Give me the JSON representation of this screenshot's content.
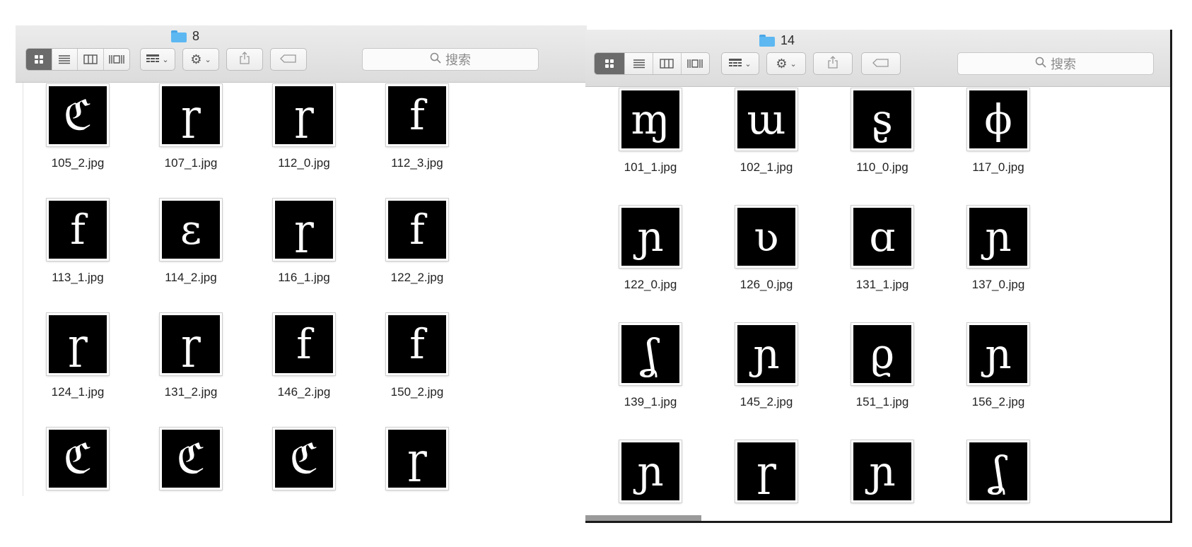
{
  "left_window": {
    "title": "8",
    "search_placeholder": "搜索",
    "files": [
      {
        "name": "105_2.jpg",
        "glyph": "ℭ"
      },
      {
        "name": "107_1.jpg",
        "glyph": "ɼ"
      },
      {
        "name": "112_0.jpg",
        "glyph": "ɼ"
      },
      {
        "name": "112_3.jpg",
        "glyph": "f"
      },
      {
        "name": "113_1.jpg",
        "glyph": "f"
      },
      {
        "name": "114_2.jpg",
        "glyph": "ɛ"
      },
      {
        "name": "116_1.jpg",
        "glyph": "ɼ"
      },
      {
        "name": "122_2.jpg",
        "glyph": "f"
      },
      {
        "name": "124_1.jpg",
        "glyph": "ɼ"
      },
      {
        "name": "131_2.jpg",
        "glyph": "ɼ"
      },
      {
        "name": "146_2.jpg",
        "glyph": "f"
      },
      {
        "name": "150_2.jpg",
        "glyph": "f"
      },
      {
        "name": "",
        "glyph": "ℭ"
      },
      {
        "name": "",
        "glyph": "ℭ"
      },
      {
        "name": "",
        "glyph": "ℭ"
      },
      {
        "name": "",
        "glyph": "ɼ"
      }
    ]
  },
  "right_window": {
    "title": "14",
    "search_placeholder": "搜索",
    "files": [
      {
        "name": "101_1.jpg",
        "glyph": "ɱ"
      },
      {
        "name": "102_1.jpg",
        "glyph": "ɯ"
      },
      {
        "name": "110_0.jpg",
        "glyph": "ʂ"
      },
      {
        "name": "117_0.jpg",
        "glyph": "ϕ"
      },
      {
        "name": "122_0.jpg",
        "glyph": "ɲ"
      },
      {
        "name": "126_0.jpg",
        "glyph": "ʋ"
      },
      {
        "name": "131_1.jpg",
        "glyph": "ɑ"
      },
      {
        "name": "137_0.jpg",
        "glyph": "ɲ"
      },
      {
        "name": "139_1.jpg",
        "glyph": "ʆ"
      },
      {
        "name": "145_2.jpg",
        "glyph": "ɲ"
      },
      {
        "name": "151_1.jpg",
        "glyph": "ϱ"
      },
      {
        "name": "156_2.jpg",
        "glyph": "ɲ"
      },
      {
        "name": "",
        "glyph": "ɲ"
      },
      {
        "name": "",
        "glyph": "ɼ"
      },
      {
        "name": "",
        "glyph": "ɲ"
      },
      {
        "name": "",
        "glyph": "ʆ"
      }
    ]
  },
  "icons": {
    "view_icon": "grid-view-icon",
    "list_icon": "list-view-icon",
    "column_icon": "column-view-icon",
    "gallery_icon": "gallery-view-icon",
    "group_icon": "group-icon",
    "action_icon": "gear-icon",
    "share_icon": "share-icon",
    "tag_icon": "tag-icon",
    "search_icon": "search-icon"
  }
}
